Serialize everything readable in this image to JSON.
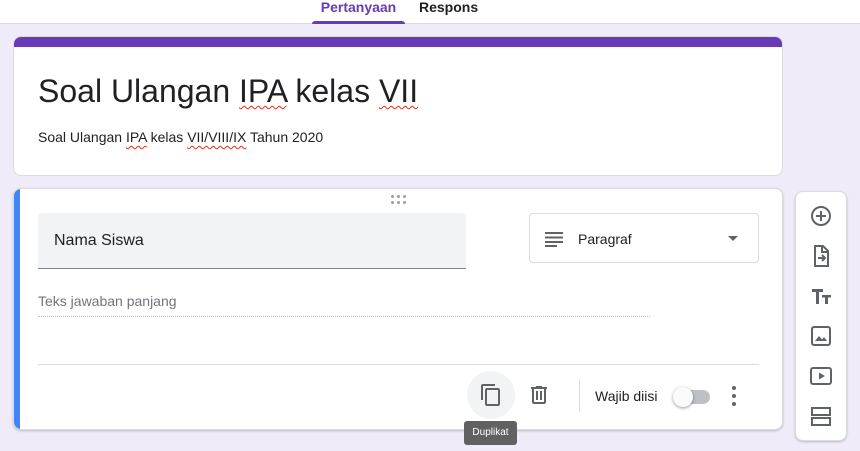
{
  "tabs": [
    {
      "label": "Pertanyaan",
      "active": true
    },
    {
      "label": "Respons",
      "active": false
    }
  ],
  "form": {
    "title_parts": [
      "Soal Ulangan ",
      "IPA",
      " kelas ",
      "VII"
    ],
    "description_parts": [
      "Soal Ulangan ",
      "IPA",
      " kelas ",
      "VII/VIII/IX",
      " Tahun 2020"
    ]
  },
  "question": {
    "title": "Nama Siswa",
    "type_label": "Paragraf",
    "answer_hint": "Teks jawaban panjang",
    "required_label": "Wajib diisi",
    "required": false
  },
  "tooltip": "Duplikat",
  "icons": {
    "question_type": "notes-icon",
    "duplicate": "content-copy-icon",
    "delete": "trash-icon",
    "more": "more-vert-icon",
    "side_tools": [
      "add-circle-icon",
      "import-questions-icon",
      "title-text-icon",
      "image-icon",
      "video-icon",
      "section-icon"
    ]
  },
  "colors": {
    "accent": "#673ab7",
    "active_question": "#4285f4",
    "background": "#f0ebf8"
  }
}
